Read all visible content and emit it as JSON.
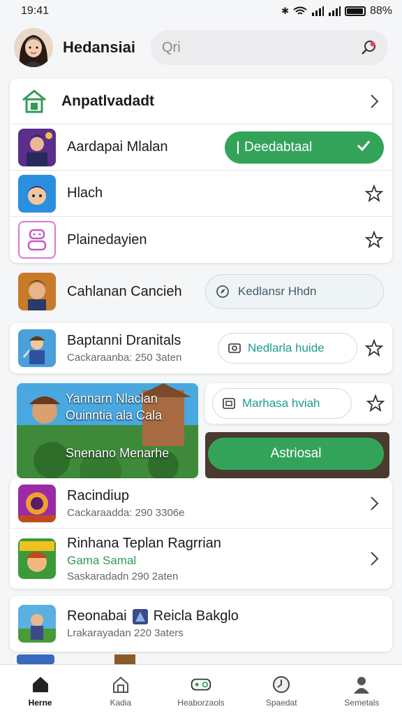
{
  "status": {
    "time": "19:41",
    "battery_text": "88%",
    "battery_level": 0.88
  },
  "header": {
    "title": "Hedansiai",
    "search_placeholder": "Qri"
  },
  "section1": {
    "header_label": "Anpatlvadadt",
    "rows": [
      {
        "label": "Aardapai Mlalan",
        "action_label": "Deedabtaal"
      },
      {
        "label": "Hlach"
      },
      {
        "label": "Plainedayien"
      }
    ]
  },
  "row_cahlanan": {
    "label": "Cahlanan Cancieh",
    "action_label": "Kedlansr Hhdn"
  },
  "row_baptanni": {
    "title": "Baptanni Dranitals",
    "sub": "Cackaraanba: 250 3aten",
    "action_label": "Nedlarla huide"
  },
  "banner": {
    "title_line1": "Yannarn Nlaclan",
    "title_line2": "Ouinntia ala Cala",
    "title_line3": "Snenano Menarhe",
    "action_label": "Marhasa hviah",
    "install_label": "Astriosal"
  },
  "list": {
    "rows": [
      {
        "title": "Racindiup",
        "sub": "Cackaraadda: 290 3306e"
      },
      {
        "title": "Rinhana Teplan Ragrrian",
        "green": "Gama Samal",
        "sub": "Saskaradadn 290 2aten"
      }
    ]
  },
  "row_reonabai": {
    "title": "Reonabai",
    "title2": "Reicla Bakglo",
    "sub": "Lrakarayadan 220 3aters"
  },
  "nav": {
    "items": [
      {
        "label": "Herne"
      },
      {
        "label": "Kadia"
      },
      {
        "label": "Heaborzaols"
      },
      {
        "label": "Spaedat"
      },
      {
        "label": "Semetals"
      }
    ]
  },
  "colors": {
    "accent_green": "#34a35a",
    "search_dot": "#e8475f"
  }
}
